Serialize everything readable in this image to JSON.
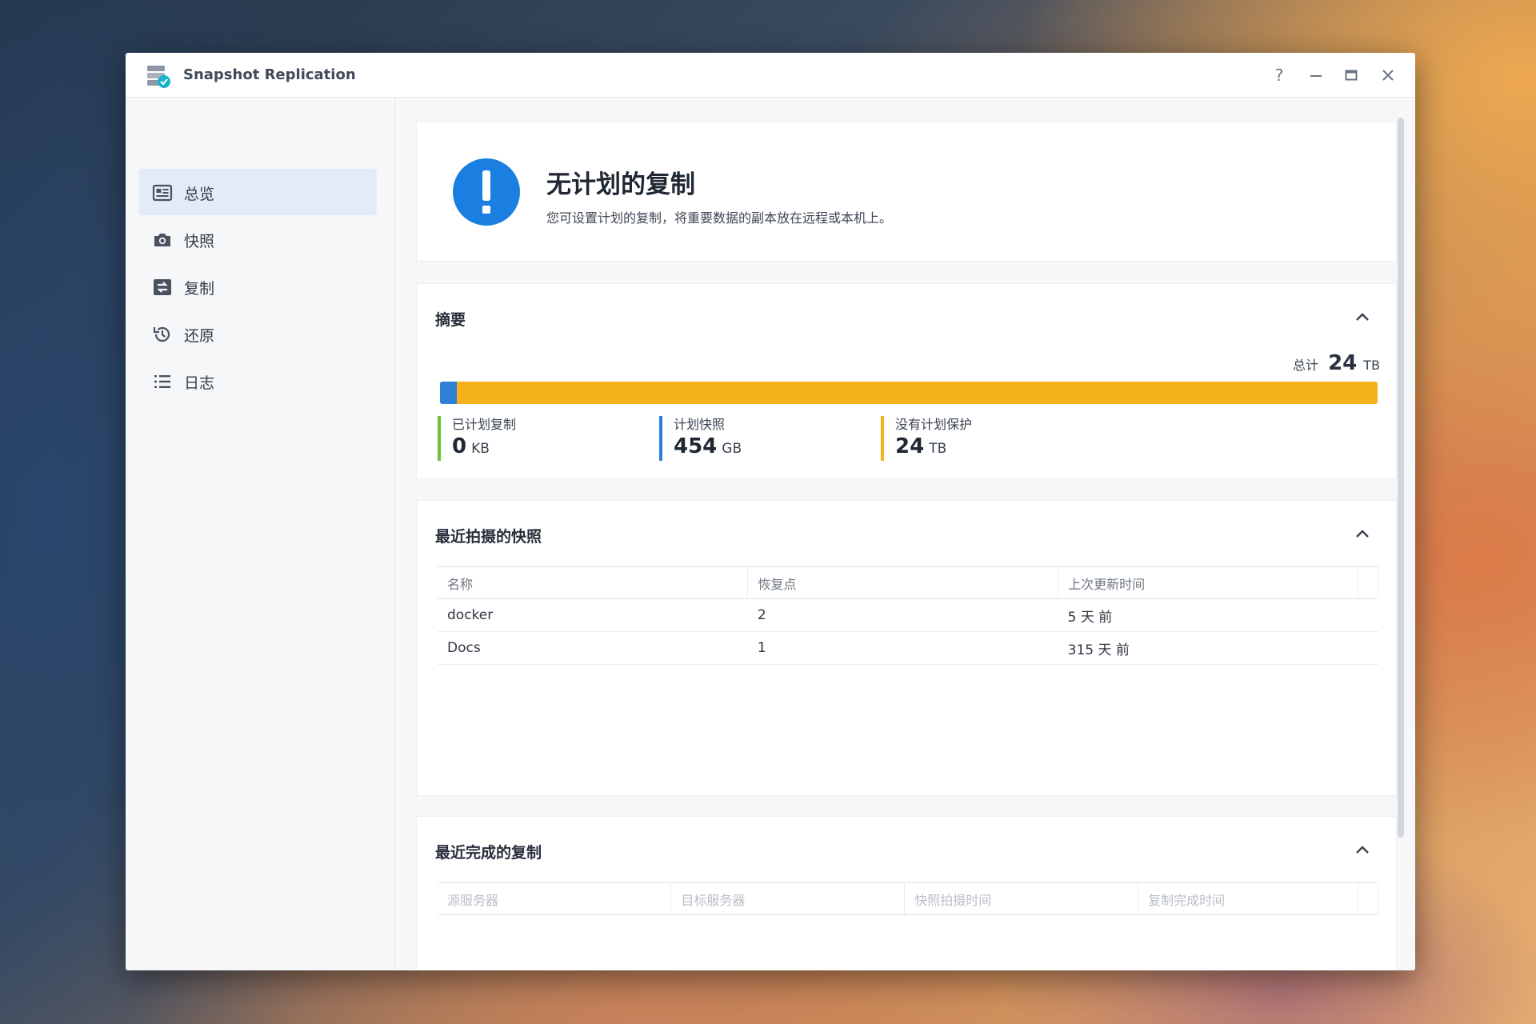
{
  "window": {
    "title": "Snapshot Replication"
  },
  "sidebar": {
    "items": [
      {
        "label": "总览",
        "icon": "overview-icon",
        "active": true
      },
      {
        "label": "快照",
        "icon": "camera-icon"
      },
      {
        "label": "复制",
        "icon": "replication-icon"
      },
      {
        "label": "还原",
        "icon": "restore-icon"
      },
      {
        "label": "日志",
        "icon": "log-list-icon"
      }
    ]
  },
  "alert": {
    "title": "无计划的复制",
    "description": "您可设置计划的复制，将重要数据的副本放在远程或本机上。",
    "color": "#1a7fe0"
  },
  "summary": {
    "title": "摘要",
    "total_label": "总计",
    "total_value": "24",
    "total_unit": "TB",
    "snapshot_fraction": 0.018,
    "stats": [
      {
        "label": "已计划复制",
        "value": "0",
        "unit": "KB",
        "color": "#6bc13c"
      },
      {
        "label": "计划快照",
        "value": "454",
        "unit": "GB",
        "color": "#2e7fd6"
      },
      {
        "label": "没有计划保护",
        "value": "24",
        "unit": "TB",
        "color": "#f6b21a"
      }
    ]
  },
  "snapshots": {
    "title": "最近拍摄的快照",
    "columns": [
      "名称",
      "恢复点",
      "上次更新时间"
    ],
    "rows": [
      [
        "docker",
        "2",
        "5 天 前"
      ],
      [
        "Docs",
        "1",
        "315 天 前"
      ]
    ]
  },
  "replications": {
    "title": "最近完成的复制",
    "columns": [
      "源服务器",
      "目标服务器",
      "快照拍摄时间",
      "复制完成时间"
    ]
  }
}
